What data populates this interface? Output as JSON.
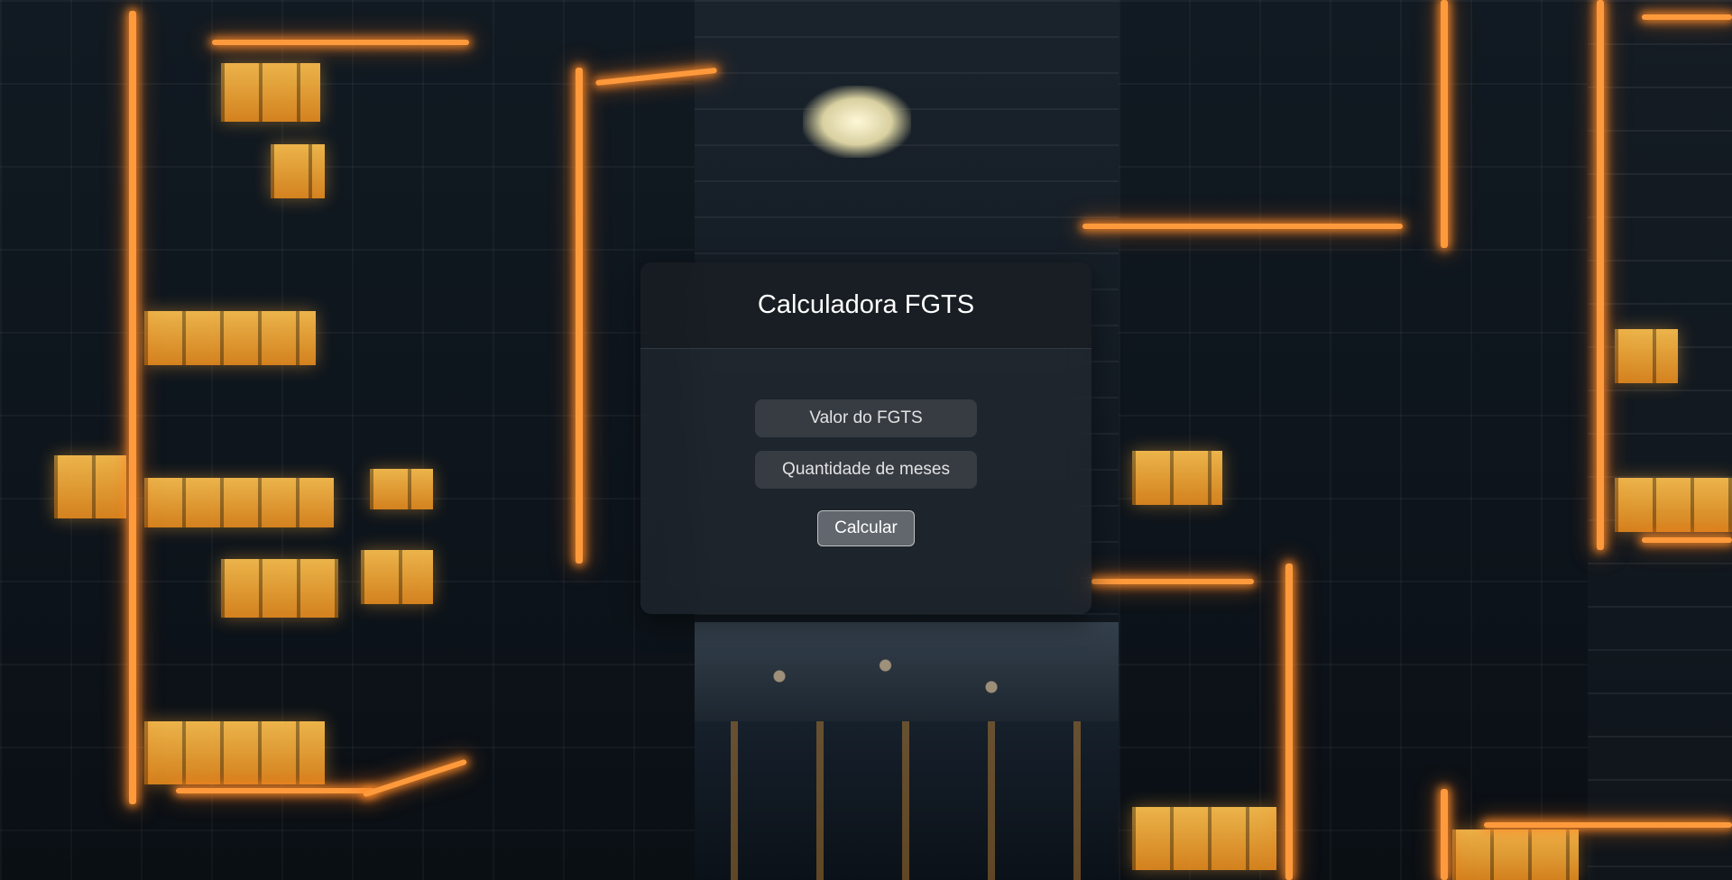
{
  "card": {
    "title": "Calculadora FGTS"
  },
  "form": {
    "fgts_value": {
      "placeholder": "Valor do FGTS",
      "value": ""
    },
    "months": {
      "placeholder": "Quantidade de meses",
      "value": ""
    },
    "submit_label": "Calcular"
  },
  "background": {
    "description_icon": "city-night-photo",
    "accent_color": "#ff9a3c"
  }
}
